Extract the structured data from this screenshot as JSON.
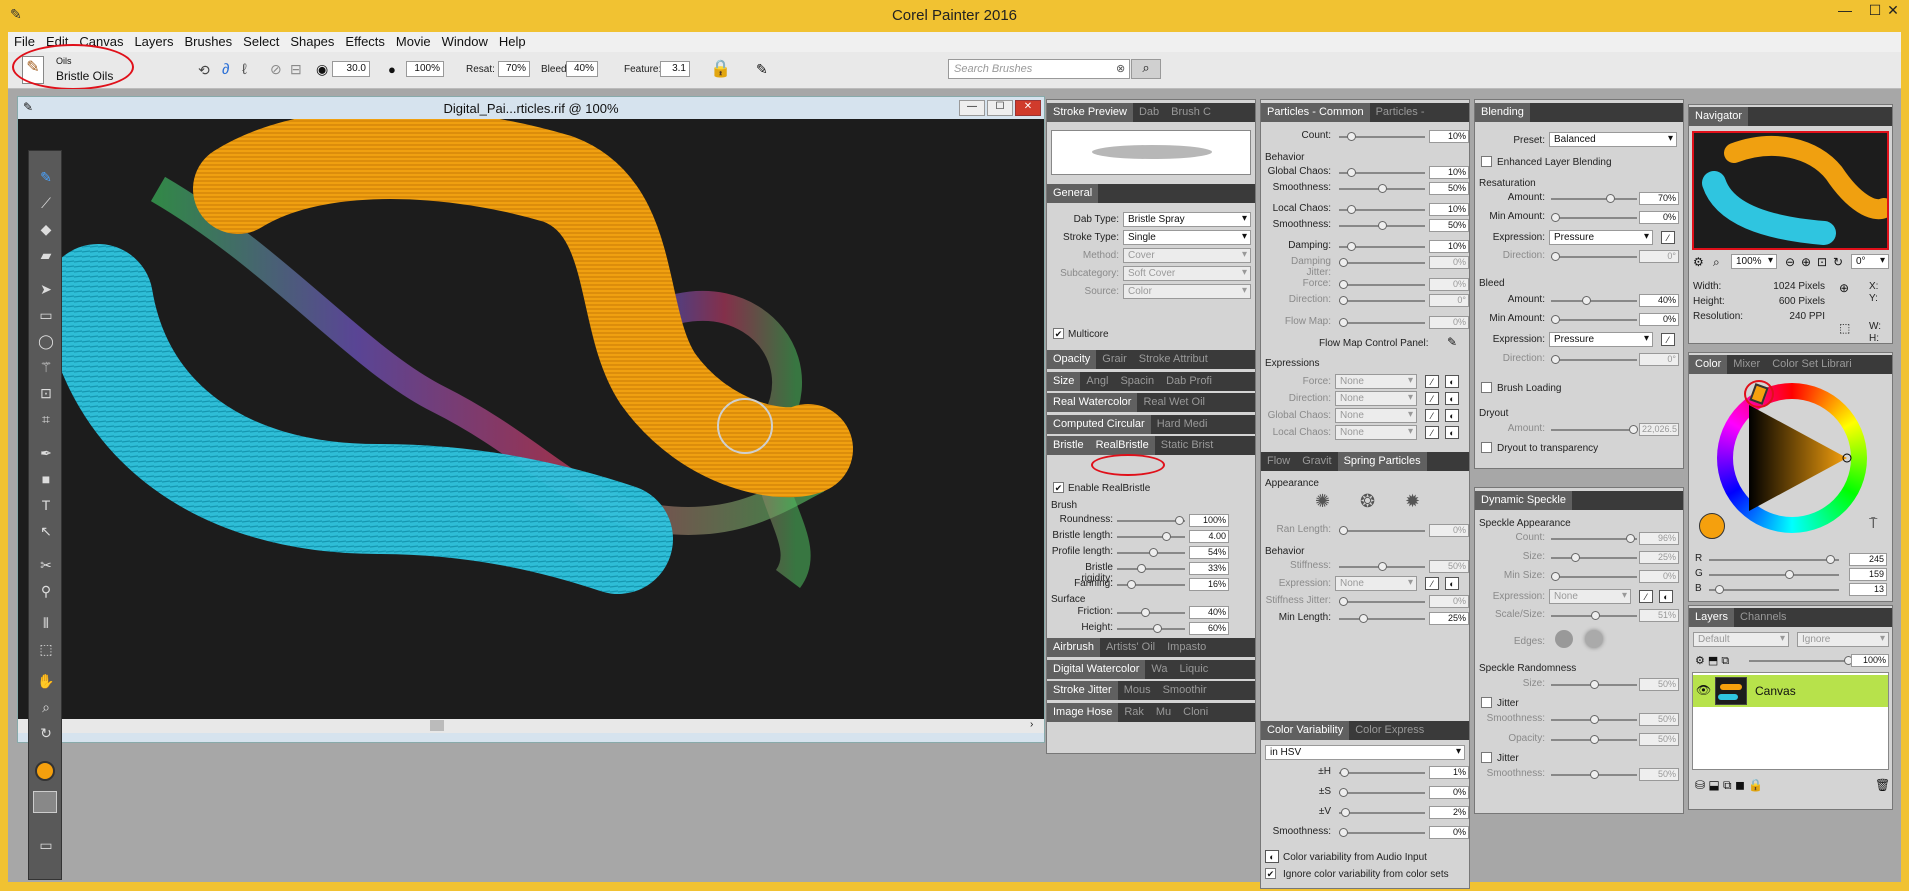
{
  "app": {
    "title": "Corel Painter 2016"
  },
  "menu": [
    "File",
    "Edit",
    "Canvas",
    "Layers",
    "Brushes",
    "Select",
    "Shapes",
    "Effects",
    "Movie",
    "Window",
    "Help"
  ],
  "props": {
    "category": "Oils",
    "variant": "Bristle Oils",
    "size": "30.0",
    "opacity": "100%",
    "resat_label": "Resat:",
    "resat": "70%",
    "bleed_label": "Bleed:",
    "bleed": "40%",
    "feature_label": "Feature:",
    "feature": "3.1",
    "search_placeholder": "Search Brushes"
  },
  "doc": {
    "title": "Digital_Pai...rticles.rif @ 100%"
  },
  "colors": {
    "orange": "#f5a00d",
    "cyan": "#2fc5e0",
    "highlight": "#e0101a",
    "canvas": "#1c1c1c",
    "chrome": "#f1c232"
  },
  "strokePanel": {
    "tabs": [
      "Stroke Preview",
      "Dab",
      "Brush C"
    ],
    "general_tab": "General",
    "general": [
      {
        "label": "Dab Type:",
        "value": "Bristle Spray"
      },
      {
        "label": "Stroke Type:",
        "value": "Single"
      },
      {
        "label": "Method:",
        "value": "Cover"
      },
      {
        "label": "Subcategory:",
        "value": "Soft Cover"
      },
      {
        "label": "Source:",
        "value": "Color"
      }
    ],
    "multicore": "Multicore",
    "rows": [
      [
        "Opacity",
        "Grair",
        "Stroke Attribut"
      ],
      [
        "Size",
        "Angl",
        "Spacin",
        "Dab Profi"
      ],
      [
        "Real Watercolor",
        "Real Wet Oil"
      ],
      [
        "Computed Circular",
        "Hard Medi"
      ],
      [
        "Bristle",
        "RealBristle",
        "Static Brist"
      ]
    ],
    "enable": "Enable RealBristle",
    "brush_label": "Brush",
    "brush": [
      {
        "label": "Roundness:",
        "value": "100%",
        "pct": 0.97
      },
      {
        "label": "Bristle length:",
        "value": "4.00",
        "pct": 0.75
      },
      {
        "label": "Profile length:",
        "value": "54%",
        "pct": 0.54
      },
      {
        "label": "Bristle rigidity:",
        "value": "33%",
        "pct": 0.33
      },
      {
        "label": "Fanning:",
        "value": "16%",
        "pct": 0.16
      }
    ],
    "surface_label": "Surface",
    "surface": [
      {
        "label": "Friction:",
        "value": "40%",
        "pct": 0.4
      },
      {
        "label": "Height:",
        "value": "60%",
        "pct": 0.6
      }
    ],
    "rows2": [
      [
        "Airbrush",
        "Artists' Oil",
        "Impasto"
      ],
      [
        "Digital Watercolor",
        "Wa",
        "Liquic"
      ],
      [
        "Stroke Jitter",
        "Mous",
        "Smoothir"
      ],
      [
        "Image Hose",
        "Rak",
        "Mu",
        "Cloni"
      ]
    ]
  },
  "particles": {
    "tabs": [
      "Particles - Common",
      "Particles -"
    ],
    "count": {
      "label": "Count:",
      "value": "10%",
      "pct": 0.1
    },
    "behavior_label": "Behavior",
    "behavior": [
      {
        "label": "Global Chaos:",
        "value": "10%",
        "pct": 0.1
      },
      {
        "label": "Smoothness:",
        "value": "50%",
        "pct": 0.5
      },
      {
        "label": "Local Chaos:",
        "value": "10%",
        "pct": 0.1
      },
      {
        "label": "Smoothness:",
        "value": "50%",
        "pct": 0.5
      },
      {
        "label": "Damping:",
        "value": "10%",
        "pct": 0.1
      },
      {
        "label": "Damping Jitter:",
        "value": "0%",
        "pct": 0
      },
      {
        "label": "Force:",
        "value": "0%",
        "pct": 0
      },
      {
        "label": "Direction:",
        "value": "0°",
        "pct": 0
      },
      {
        "label": "Flow Map:",
        "value": "0%",
        "pct": 0
      }
    ],
    "flowmap": "Flow Map Control Panel:",
    "expr_label": "Expressions",
    "exprs": [
      {
        "label": "Force:",
        "value": "None"
      },
      {
        "label": "Direction:",
        "value": "None"
      },
      {
        "label": "Global Chaos:",
        "value": "None"
      },
      {
        "label": "Local Chaos:",
        "value": "None"
      }
    ],
    "spring_tabs": [
      "Flow",
      "Gravit",
      "Spring Particles"
    ],
    "appearance": "Appearance",
    "ranlength": {
      "label": "Ran Length:",
      "value": "0%",
      "pct": 0
    },
    "behavior2": "Behavior",
    "spring": [
      {
        "label": "Stiffness:",
        "value": "50%",
        "pct": 0.5
      },
      {
        "label": "Stiffness Jitter:",
        "value": "0%",
        "pct": 0
      },
      {
        "label": "Min Length:",
        "value": "25%",
        "pct": 0.25
      }
    ],
    "expression": {
      "label": "Expression:",
      "value": "None"
    },
    "cv_tabs": [
      "Color Variability",
      "Color Express"
    ],
    "cv_mode": "in HSV",
    "cv": [
      {
        "label": "±H",
        "value": "1%",
        "pct": 0.01
      },
      {
        "label": "±S",
        "value": "0%",
        "pct": 0
      },
      {
        "label": "±V",
        "value": "2%",
        "pct": 0.02
      },
      {
        "label": "Smoothness:",
        "value": "0%",
        "pct": 0
      }
    ],
    "cv_audio": "Color variability from Audio Input",
    "cv_ignore": "Ignore color variability from color sets"
  },
  "blending": {
    "tab": "Blending",
    "preset_label": "Preset:",
    "preset": "Balanced",
    "enhanced": "Enhanced Layer Blending",
    "resat_label": "Resaturation",
    "resat": [
      {
        "label": "Amount:",
        "value": "70%",
        "pct": 0.7
      },
      {
        "label": "Min Amount:",
        "value": "0%",
        "pct": 0
      }
    ],
    "resat_expr": "Pressure",
    "resat_dir": {
      "label": "Direction:",
      "value": "0°"
    },
    "bleed_label": "Bleed",
    "bleed": [
      {
        "label": "Amount:",
        "value": "40%",
        "pct": 0.4
      },
      {
        "label": "Min Amount:",
        "value": "0%",
        "pct": 0
      }
    ],
    "bleed_expr": "Pressure",
    "bleed_dir": {
      "label": "Direction:",
      "value": "0°"
    },
    "expression_label": "Expression:",
    "brush_loading": "Brush Loading",
    "dryout_label": "Dryout",
    "dryout": {
      "label": "Amount:",
      "value": "22,026.5"
    },
    "dryout_transp": "Dryout to transparency"
  },
  "speckle": {
    "tab": "Dynamic Speckle",
    "app_label": "Speckle Appearance",
    "app": [
      {
        "label": "Count:",
        "value": "96%",
        "pct": 0.96
      },
      {
        "label": "Size:",
        "value": "25%",
        "pct": 0.25
      },
      {
        "label": "Min Size:",
        "value": "0%",
        "pct": 0
      },
      {
        "label": "Expression:",
        "value": "None"
      },
      {
        "label": "Scale/Size:",
        "value": "51%",
        "pct": 0.51
      }
    ],
    "edges": "Edges:",
    "rand_label": "Speckle Randomness",
    "rand": [
      {
        "label": "Size:",
        "value": "50%",
        "pct": 0.5
      },
      {
        "label": "Smoothness:",
        "value": "50%",
        "pct": 0.5
      },
      {
        "label": "Opacity:",
        "value": "50%",
        "pct": 0.5
      },
      {
        "label": "Smoothness:",
        "value": "50%",
        "pct": 0.5
      }
    ],
    "jitter": "Jitter"
  },
  "navigator": {
    "tab": "Navigator",
    "zoom": "100%",
    "angle": "0°",
    "info": [
      {
        "label": "Width:",
        "value": "1024 Pixels"
      },
      {
        "label": "Height:",
        "value": "600 Pixels"
      },
      {
        "label": "Resolution:",
        "value": "240 PPI"
      }
    ],
    "coords": [
      "X:",
      "Y:",
      "W:",
      "H:"
    ]
  },
  "colorpanel": {
    "tabs": [
      "Color",
      "Mixer",
      "Color Set Librari"
    ],
    "rgb": [
      {
        "label": "R",
        "value": "245",
        "pct": 0.96
      },
      {
        "label": "G",
        "value": "159",
        "pct": 0.62
      },
      {
        "label": "B",
        "value": "13",
        "pct": 0.05
      }
    ]
  },
  "layers": {
    "tabs": [
      "Layers",
      "Channels"
    ],
    "composite": "Default",
    "method": "Ignore",
    "opacity": "100%",
    "items": [
      "Canvas"
    ]
  }
}
